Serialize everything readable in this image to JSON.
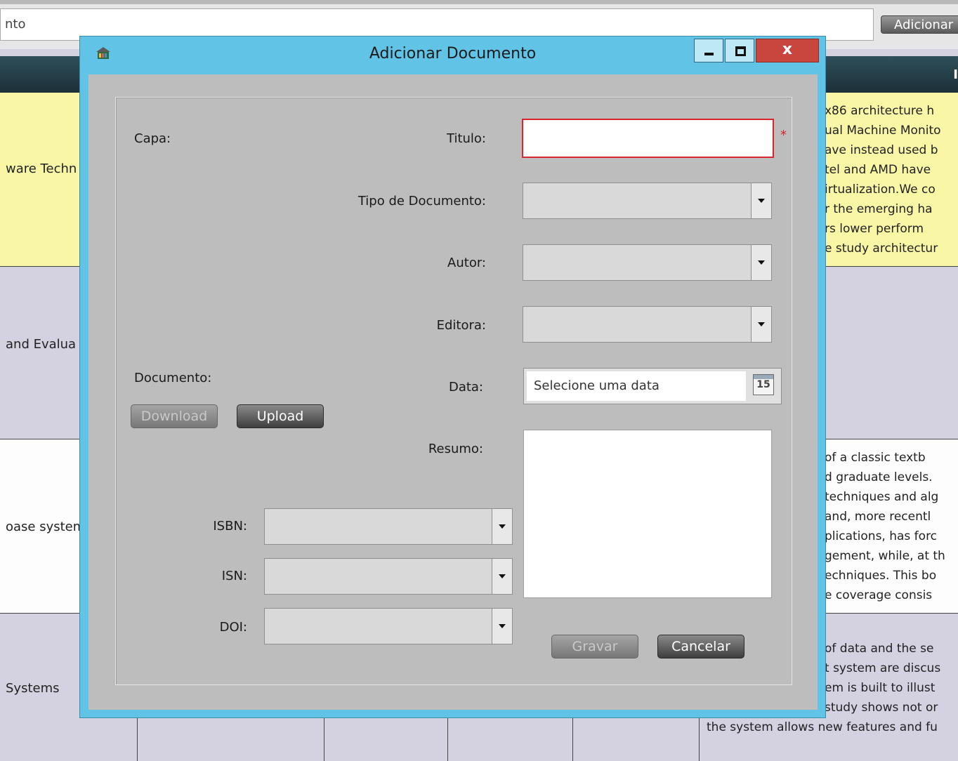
{
  "background": {
    "search_text": "nto",
    "add_button_label": "Adicionar",
    "header_char": "I",
    "rows": [
      {
        "left": "ware Techn",
        "right": [
          "x86 architecture h",
          "ual Machine Monito",
          "ave instead used b",
          "tel and AMD have",
          "irtualization.We co",
          "r the emerging ha",
          "rs lower perform",
          "e study architectur"
        ]
      },
      {
        "left": "and Evalua",
        "right": []
      },
      {
        "left": "oase system",
        "right": [
          "of a classic textb",
          "d graduate levels.",
          "techniques and alg",
          "and, more recentl",
          "plications, has forc",
          "gement, while, at th",
          "echniques. This bo",
          "e coverage consis"
        ]
      },
      {
        "left": "Systems",
        "right": [
          "of data and the se",
          "t system are discus",
          "em is built to illust",
          "study shows not or",
          "the system allows new features and fu"
        ]
      }
    ]
  },
  "dialog": {
    "title": "Adicionar Documento",
    "close_label": "x",
    "labels": {
      "capa": "Capa:",
      "titulo": "Titulo:",
      "tipo_documento": "Tipo de Documento:",
      "autor": "Autor:",
      "editora": "Editora:",
      "documento": "Documento:",
      "data": "Data:",
      "resumo": "Resumo:",
      "isbn": "ISBN:",
      "isn": "ISN:",
      "doi": "DOI:"
    },
    "titulo_value": "",
    "required_marker": "*",
    "date_placeholder": "Selecione uma data",
    "calendar_day": "15",
    "buttons": {
      "download": "Download",
      "upload": "Upload",
      "gravar": "Gravar",
      "cancelar": "Cancelar"
    },
    "colors": {
      "dialog_frame": "#61c4e6",
      "client_bg": "#bdbdbd",
      "close_button": "#c8463d",
      "required": "#d9252b"
    }
  }
}
